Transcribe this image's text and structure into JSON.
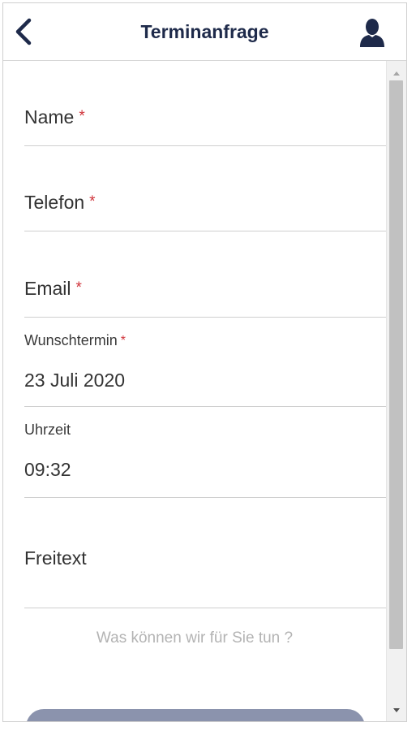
{
  "header": {
    "title": "Terminanfrage",
    "back_icon": "chevron-left-icon",
    "profile_icon": "user-icon"
  },
  "form": {
    "name": {
      "label": "Name",
      "required_mark": "*"
    },
    "telefon": {
      "label": "Telefon",
      "required_mark": "*"
    },
    "email": {
      "label": "Email",
      "required_mark": "*"
    },
    "wunschtermin": {
      "label": "Wunschtermin",
      "required_mark": "*",
      "value": "23 Juli 2020"
    },
    "uhrzeit": {
      "label": "Uhrzeit",
      "value": "09:32"
    },
    "freitext": {
      "label": "Freitext",
      "hint": "Was können wir für Sie tun ?"
    }
  },
  "colors": {
    "accent_dark": "#1e2a4a",
    "required": "#d0343b",
    "button": "#8b93ad",
    "hint": "#b3b3b3"
  }
}
